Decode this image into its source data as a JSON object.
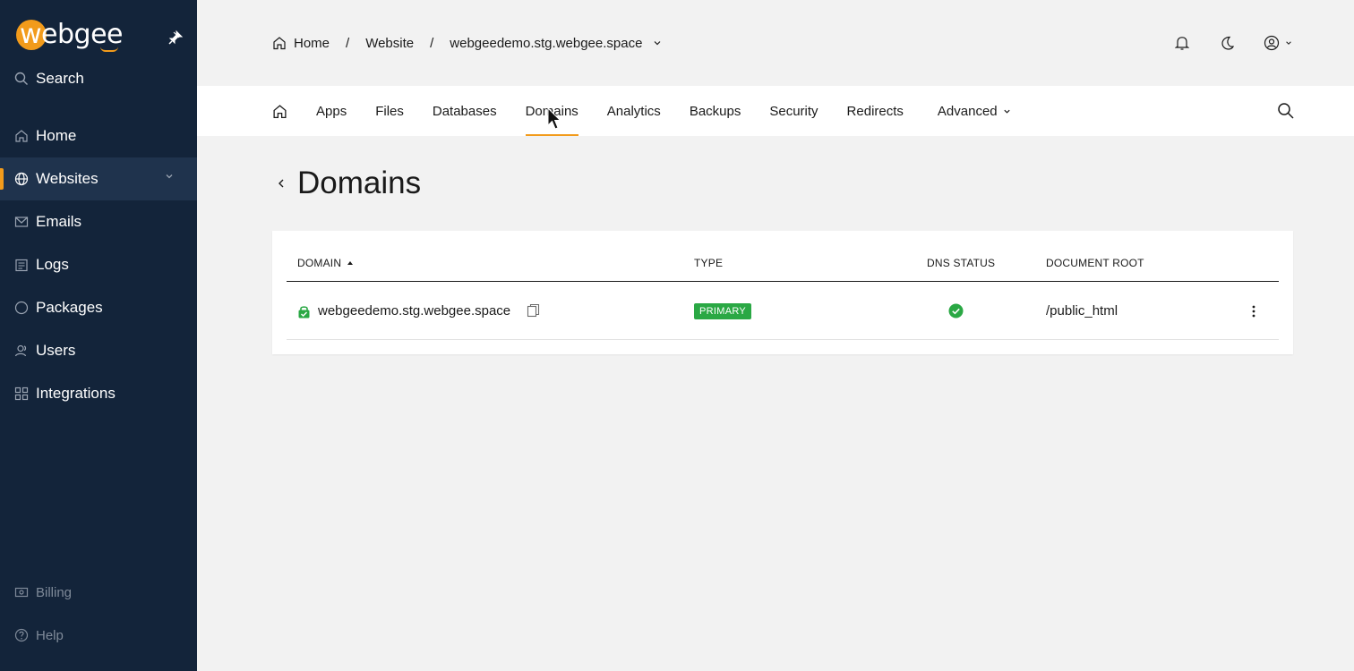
{
  "brand": {
    "name": "webgee",
    "accent": "#f29b1b",
    "sidebar_bg": "#13243a"
  },
  "sidebar": {
    "search_label": "Search",
    "items": [
      {
        "label": "Home",
        "icon": "home-icon"
      },
      {
        "label": "Websites",
        "icon": "globe-icon",
        "active": true
      },
      {
        "label": "Emails",
        "icon": "mail-icon"
      },
      {
        "label": "Logs",
        "icon": "logs-icon"
      },
      {
        "label": "Packages",
        "icon": "package-icon"
      },
      {
        "label": "Users",
        "icon": "users-icon"
      },
      {
        "label": "Integrations",
        "icon": "integrations-icon"
      }
    ],
    "bottom": [
      {
        "label": "Billing",
        "icon": "billing-icon"
      },
      {
        "label": "Help",
        "icon": "help-icon"
      }
    ]
  },
  "breadcrumb": {
    "home": "Home",
    "sep": "/",
    "website": "Website",
    "domain": "webgeedemo.stg.webgee.space"
  },
  "tabs": [
    "Apps",
    "Files",
    "Databases",
    "Domains",
    "Analytics",
    "Backups",
    "Security",
    "Redirects",
    "Advanced"
  ],
  "active_tab": "Domains",
  "page": {
    "title": "Domains"
  },
  "table": {
    "headers": {
      "domain": "DOMAIN",
      "type": "TYPE",
      "dns_status": "DNS STATUS",
      "document_root": "DOCUMENT ROOT"
    },
    "rows": [
      {
        "domain": "webgeedemo.stg.webgee.space",
        "type": "PRIMARY",
        "dns_ok": true,
        "document_root": "/public_html"
      }
    ],
    "badge_color": "#2aa844"
  }
}
